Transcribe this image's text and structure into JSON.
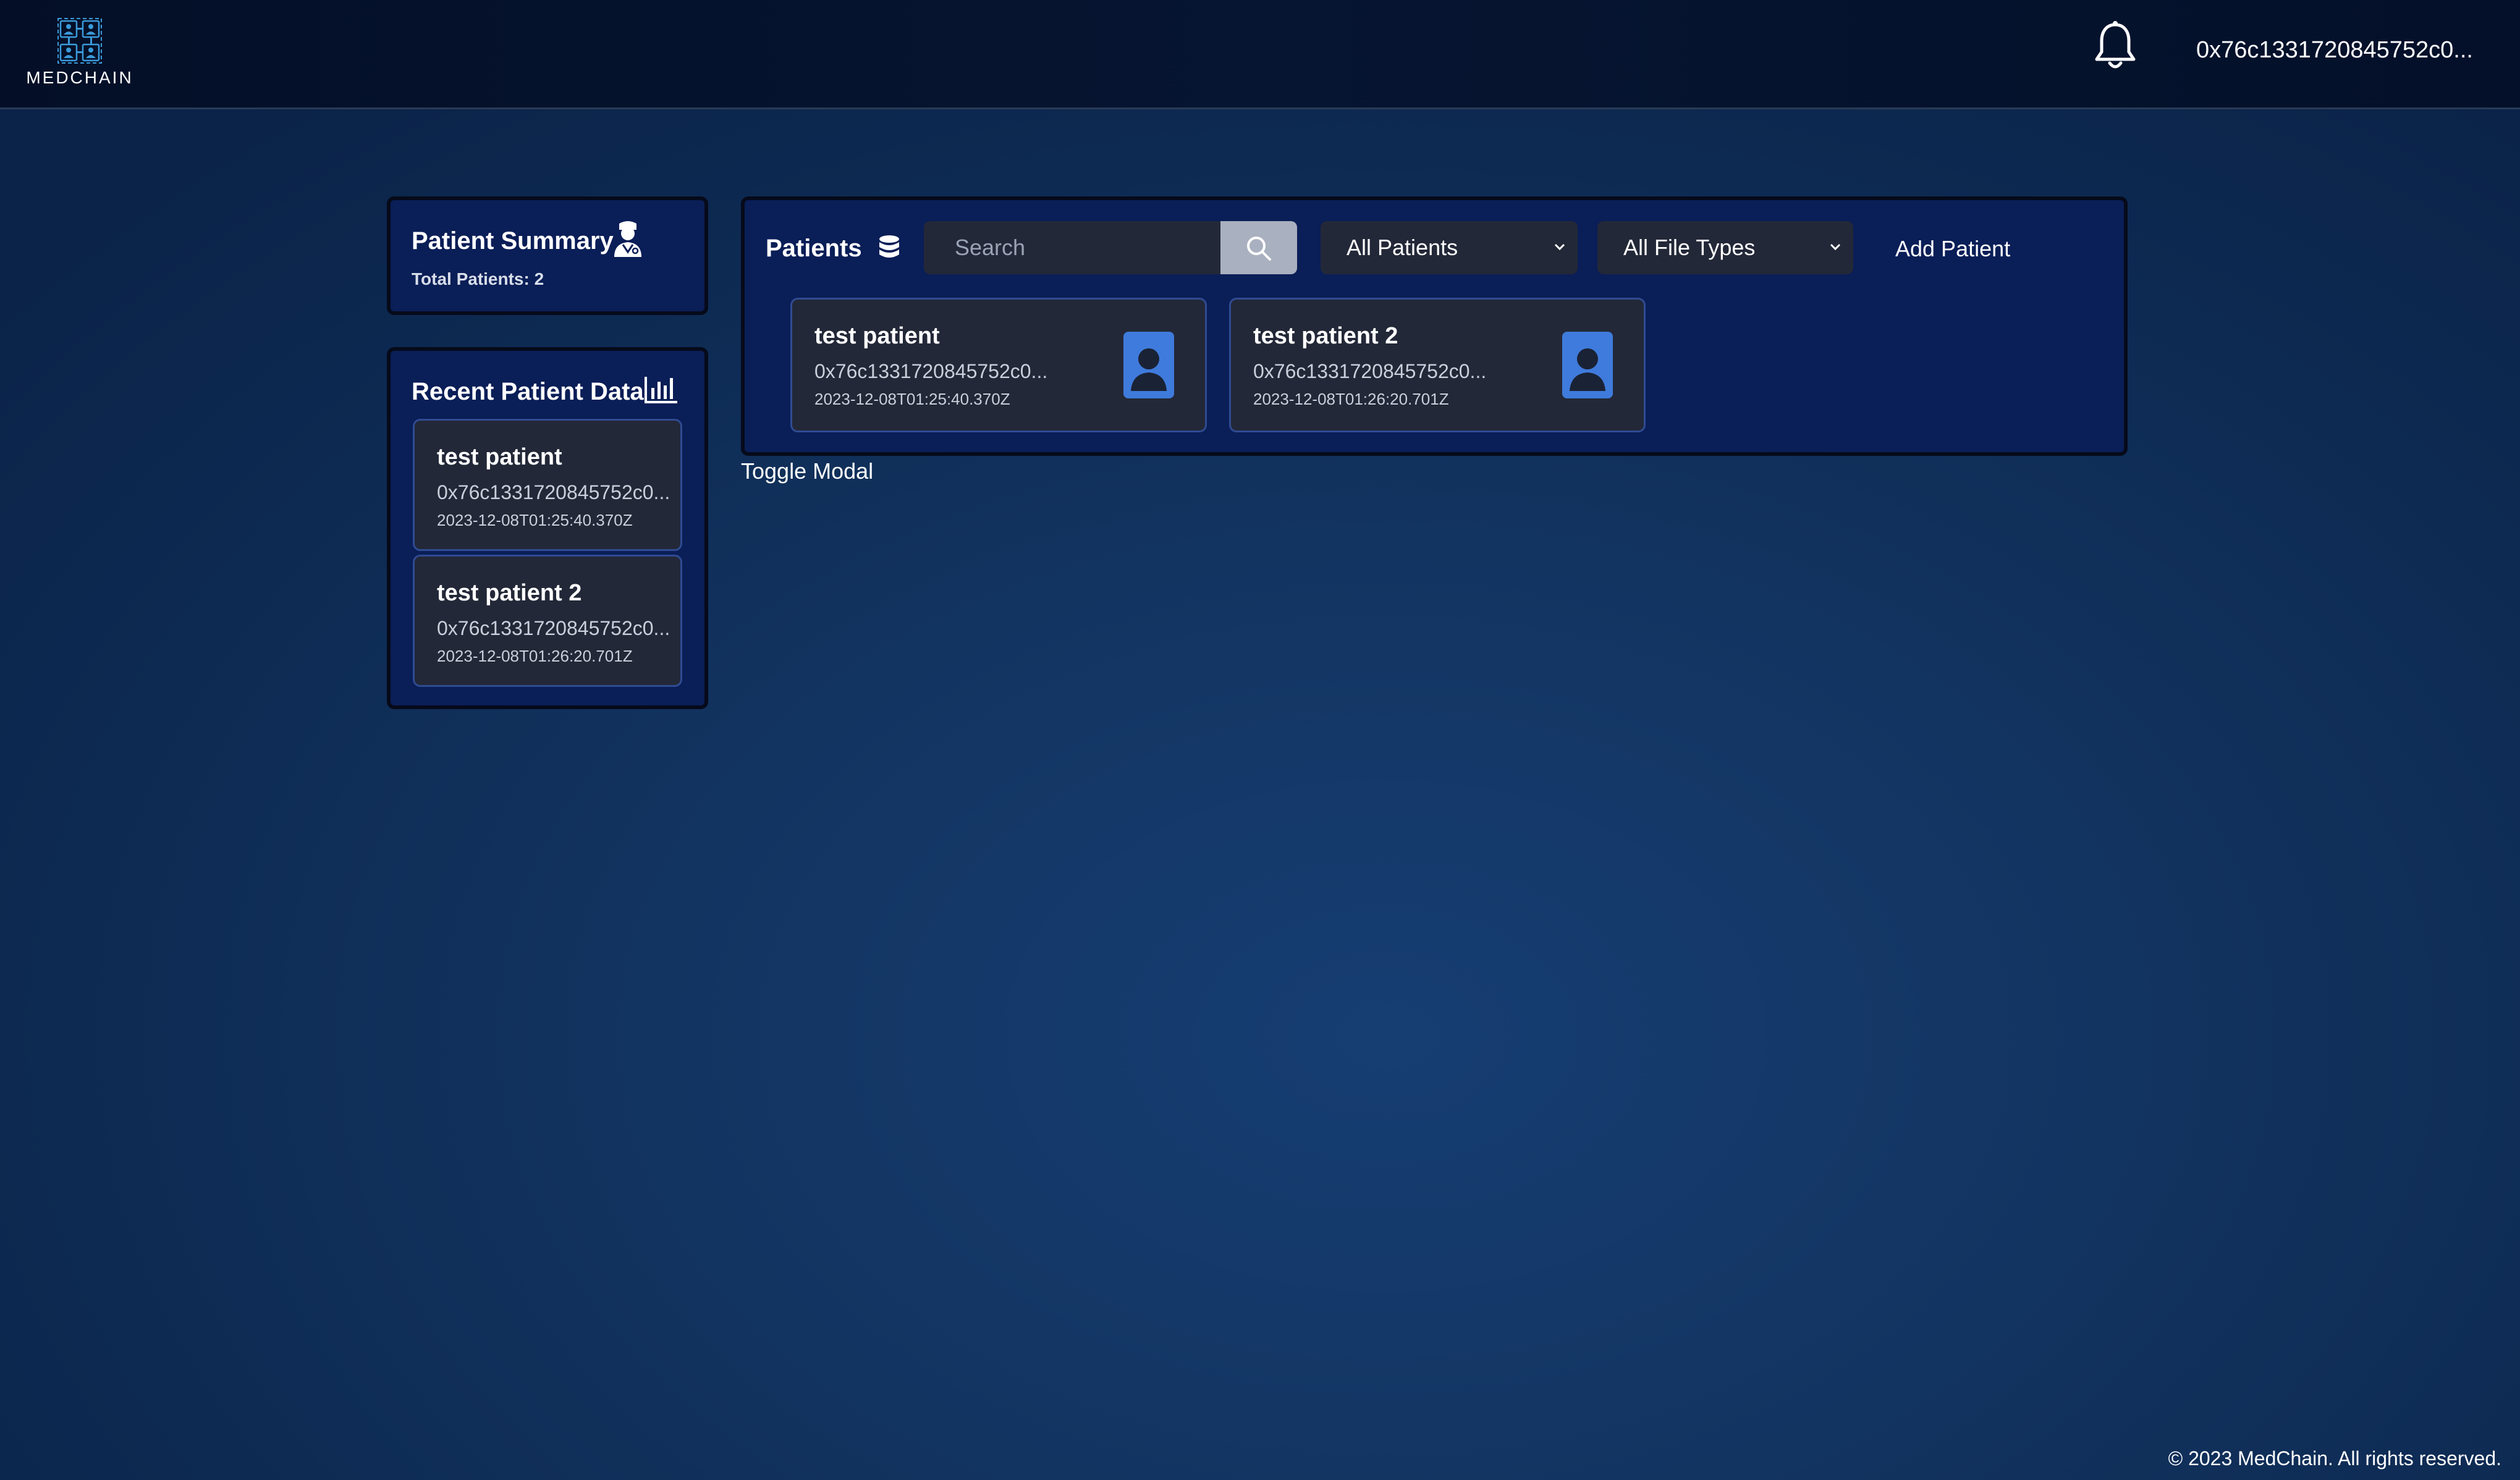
{
  "header": {
    "logo_text": "MEDCHAIN",
    "wallet_address": "0x76c1331720845752c0..."
  },
  "summary": {
    "title": "Patient Summary",
    "total_patients": "Total Patients: 2",
    "icon": "doctor-icon"
  },
  "recent": {
    "title": "Recent Patient Data",
    "icon": "bar-chart-icon",
    "items": [
      {
        "name": "test patient",
        "address": "0x76c1331720845752c0...",
        "date": "2023-12-08T01:25:40.370Z"
      },
      {
        "name": "test patient 2",
        "address": "0x76c1331720845752c0...",
        "date": "2023-12-08T01:26:20.701Z"
      }
    ]
  },
  "patients": {
    "title": "Patients",
    "icon": "database-icon",
    "search_placeholder": "Search",
    "filter_patients": "All Patients",
    "filter_file_types": "All File Types",
    "add_patient": "Add Patient",
    "cards": [
      {
        "name": "test patient",
        "address": "0x76c1331720845752c0...",
        "date": "2023-12-08T01:25:40.370Z"
      },
      {
        "name": "test patient 2",
        "address": "0x76c1331720845752c0...",
        "date": "2023-12-08T01:26:20.701Z"
      }
    ]
  },
  "toggle_modal": "Toggle Modal",
  "footer": "© 2023 MedChain. All rights reserved.",
  "colors": {
    "panel": "#0a1e57",
    "card": "#232838",
    "card_border": "#2f4b92",
    "avatar": "#3f7bdc",
    "accent_logo": "#3a9ad9"
  }
}
